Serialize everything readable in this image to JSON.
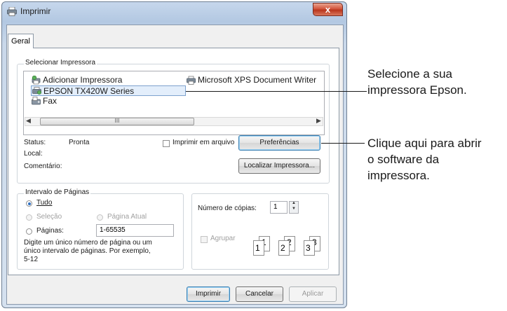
{
  "window": {
    "title": "Imprimir",
    "close_glyph": "x"
  },
  "tabs": [
    {
      "label": "Geral"
    }
  ],
  "printer_select": {
    "legend": "Selecionar Impressora",
    "printers": [
      {
        "name": "Adicionar Impressora",
        "icon": "add-printer-icon"
      },
      {
        "name": "Microsoft XPS Document Writer",
        "icon": "printer-icon"
      },
      {
        "name": "EPSON TX420W Series",
        "icon": "printer-icon",
        "selected": true
      },
      {
        "name": "Fax",
        "icon": "fax-icon"
      }
    ],
    "scroll_thumb": "III",
    "status_label": "Status:",
    "status_value": "Pronta",
    "location_label": "Local:",
    "comment_label": "Comentário:",
    "print_to_file_label": "Imprimir em arquivo",
    "preferences_button": "Preferências",
    "find_printer_button": "Localizar Impressora..."
  },
  "page_range": {
    "legend": "Intervalo de Páginas",
    "all_label": "Tudo",
    "selection_label": "Seleção",
    "current_page_label": "Página Atual",
    "pages_label": "Páginas:",
    "pages_value": "1-65535",
    "hint_lines": [
      "Digite um único número de página ou um",
      "único intervalo de páginas. Por exemplo,",
      "5-12"
    ]
  },
  "copies": {
    "label": "Número de cópias:",
    "value": "1",
    "collate_label": "Agrupar",
    "collate_pages": [
      "1",
      "1",
      "2",
      "2",
      "3",
      "3"
    ]
  },
  "footer": {
    "print_button": "Imprimir",
    "cancel_button": "Cancelar",
    "apply_button": "Aplicar"
  },
  "annotations": {
    "select_printer": [
      "Selecione a sua",
      "impressora Epson."
    ],
    "open_software": [
      "Clique aqui para abrir",
      "o software da",
      "impressora."
    ]
  },
  "colors": {
    "accent": "#2f6fc1",
    "close": "#c9432a",
    "selection": "#e3eefb"
  }
}
